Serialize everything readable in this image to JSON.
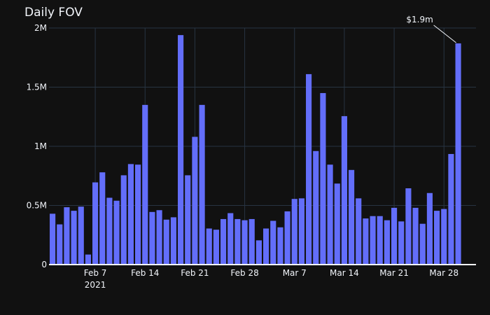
{
  "chart_data": {
    "type": "bar",
    "title": "Daily FOV",
    "xlabel": "",
    "ylabel": "",
    "start_date": "2021-02-01",
    "x_range": [
      "2021-01-31T12:00",
      "2021-04-01T12:00"
    ],
    "x_ticks": [
      {
        "date": "2021-02-07",
        "label": "Feb 7",
        "sublabel": "2021"
      },
      {
        "date": "2021-02-14",
        "label": "Feb 14"
      },
      {
        "date": "2021-02-21",
        "label": "Feb 21"
      },
      {
        "date": "2021-02-28",
        "label": "Feb 28"
      },
      {
        "date": "2021-03-07",
        "label": "Mar 7"
      },
      {
        "date": "2021-03-14",
        "label": "Mar 14"
      },
      {
        "date": "2021-03-21",
        "label": "Mar 21"
      },
      {
        "date": "2021-03-28",
        "label": "Mar 28"
      }
    ],
    "y_ticks": [
      {
        "value": 0,
        "label": "0"
      },
      {
        "value": 500000,
        "label": "0.5M"
      },
      {
        "value": 1000000,
        "label": "1M"
      },
      {
        "value": 1500000,
        "label": "1.5M"
      },
      {
        "value": 2000000,
        "label": "2M"
      }
    ],
    "ylim": [
      0,
      2000000
    ],
    "grid": true,
    "bar_color": "#636efa",
    "dates": [
      "2021-02-01",
      "2021-02-02",
      "2021-02-03",
      "2021-02-04",
      "2021-02-05",
      "2021-02-06",
      "2021-02-07",
      "2021-02-08",
      "2021-02-09",
      "2021-02-10",
      "2021-02-11",
      "2021-02-12",
      "2021-02-13",
      "2021-02-14",
      "2021-02-15",
      "2021-02-16",
      "2021-02-17",
      "2021-02-18",
      "2021-02-19",
      "2021-02-20",
      "2021-02-21",
      "2021-02-22",
      "2021-02-23",
      "2021-02-24",
      "2021-02-25",
      "2021-02-26",
      "2021-02-27",
      "2021-02-28",
      "2021-03-01",
      "2021-03-02",
      "2021-03-03",
      "2021-03-04",
      "2021-03-05",
      "2021-03-06",
      "2021-03-07",
      "2021-03-08",
      "2021-03-09",
      "2021-03-10",
      "2021-03-11",
      "2021-03-12",
      "2021-03-13",
      "2021-03-14",
      "2021-03-15",
      "2021-03-16",
      "2021-03-17",
      "2021-03-18",
      "2021-03-19",
      "2021-03-20",
      "2021-03-21",
      "2021-03-22",
      "2021-03-23",
      "2021-03-24",
      "2021-03-25",
      "2021-03-26",
      "2021-03-27",
      "2021-03-28",
      "2021-03-29",
      "2021-03-30",
      "2021-03-31"
    ],
    "values": [
      430000,
      340000,
      485000,
      455000,
      490000,
      85000,
      695000,
      780000,
      565000,
      540000,
      755000,
      850000,
      845000,
      1350000,
      445000,
      460000,
      380000,
      400000,
      1940000,
      755000,
      1080000,
      1350000,
      305000,
      295000,
      385000,
      435000,
      385000,
      375000,
      385000,
      205000,
      305000,
      370000,
      315000,
      450000,
      555000,
      560000,
      1610000,
      960000,
      1450000,
      845000,
      685000,
      1255000,
      800000,
      560000,
      390000,
      410000,
      410000,
      375000,
      480000,
      365000,
      645000,
      480000,
      345000,
      605000,
      455000,
      470000,
      935000,
      1870000,
      0
    ],
    "annotations": [
      {
        "date": "2021-03-30",
        "value": 1870000,
        "text": "$1.9m"
      }
    ]
  }
}
